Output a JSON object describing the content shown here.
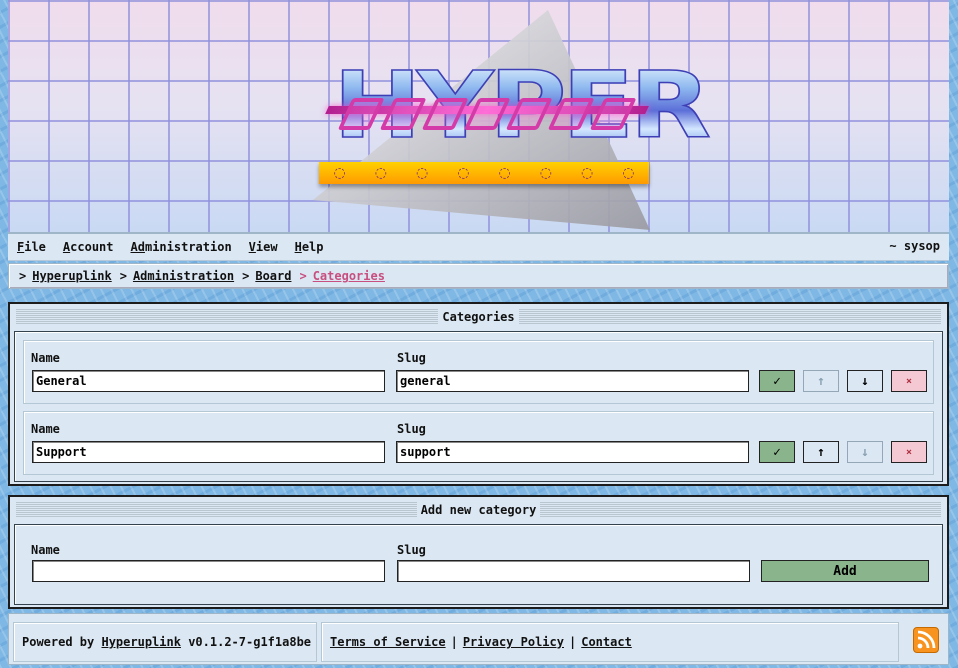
{
  "menu": {
    "items": [
      {
        "label": "File",
        "accel": "F",
        "rest": "ile"
      },
      {
        "label": "Account",
        "accel": "A",
        "rest": "ccount"
      },
      {
        "label": "Administration",
        "accel": "Ad",
        "rest": "ministration"
      },
      {
        "label": "View",
        "accel": "V",
        "rest": "iew"
      },
      {
        "label": "Help",
        "accel": "H",
        "rest": "elp"
      }
    ],
    "user": "~ sysop"
  },
  "breadcrumb": {
    "items": [
      "Hyperuplink",
      "Administration",
      "Board"
    ],
    "current": "Categories",
    "separator": ">"
  },
  "categories_panel": {
    "title": "Categories",
    "name_label": "Name",
    "slug_label": "Slug",
    "rows": [
      {
        "name": "General",
        "slug": "general",
        "up_enabled": false,
        "down_enabled": true
      },
      {
        "name": "Support",
        "slug": "support",
        "up_enabled": true,
        "down_enabled": false
      }
    ],
    "save_icon": "✓",
    "up_icon": "↑",
    "down_icon": "↓",
    "delete_icon": "×"
  },
  "add_panel": {
    "title": "Add new category",
    "name_label": "Name",
    "slug_label": "Slug",
    "name_value": "",
    "slug_value": "",
    "add_label": "Add"
  },
  "footer": {
    "powered_prefix": "Powered by",
    "powered_link": "Hyperuplink",
    "version": "v0.1.2-7-g1f1a8be",
    "links": [
      "Terms of Service",
      "Privacy Policy",
      "Contact"
    ]
  },
  "colors": {
    "accent_green": "#8ab48c",
    "delete_pink": "#f5c9d3",
    "current_crumb": "#c84f7f"
  }
}
